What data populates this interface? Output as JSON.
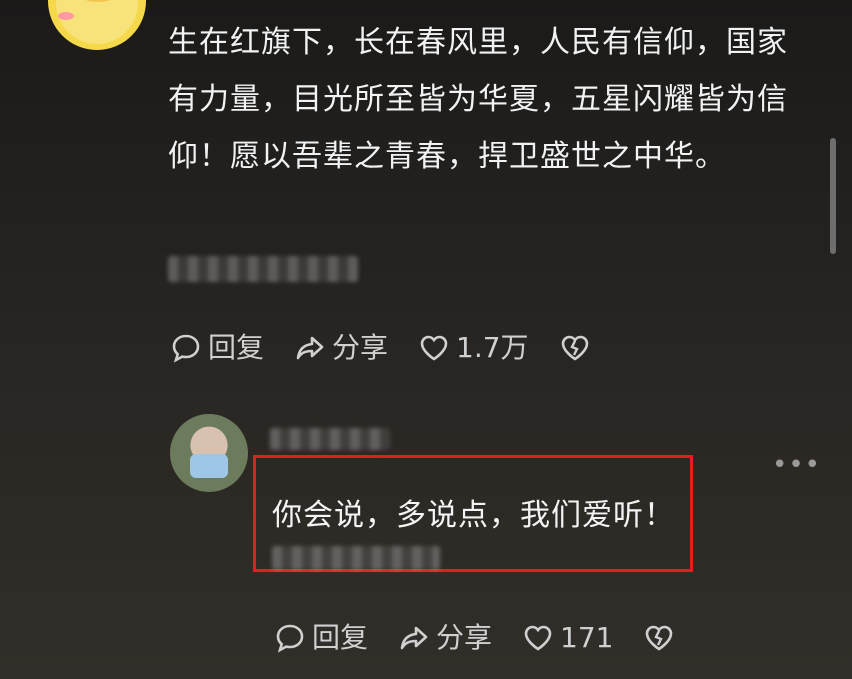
{
  "comment": {
    "text": "生在红旗下，长在春风里，人民有信仰，国家有力量，目光所至皆为华夏，五星闪耀皆为信仰！愿以吾辈之青春，捍卫盛世之中华。",
    "actions": {
      "reply_label": "回复",
      "share_label": "分享",
      "like_count": "1.7万"
    }
  },
  "reply": {
    "text": "你会说，多说点，我们爱听！",
    "more_label": "•••",
    "actions": {
      "reply_label": "回复",
      "share_label": "分享",
      "like_count": "171"
    }
  },
  "colors": {
    "highlight": "#e02020",
    "avatar_yellow": "#f6d94a"
  },
  "icons": [
    "comment-bubble-icon",
    "share-arrow-icon",
    "heart-icon",
    "broken-heart-icon",
    "more-icon"
  ]
}
